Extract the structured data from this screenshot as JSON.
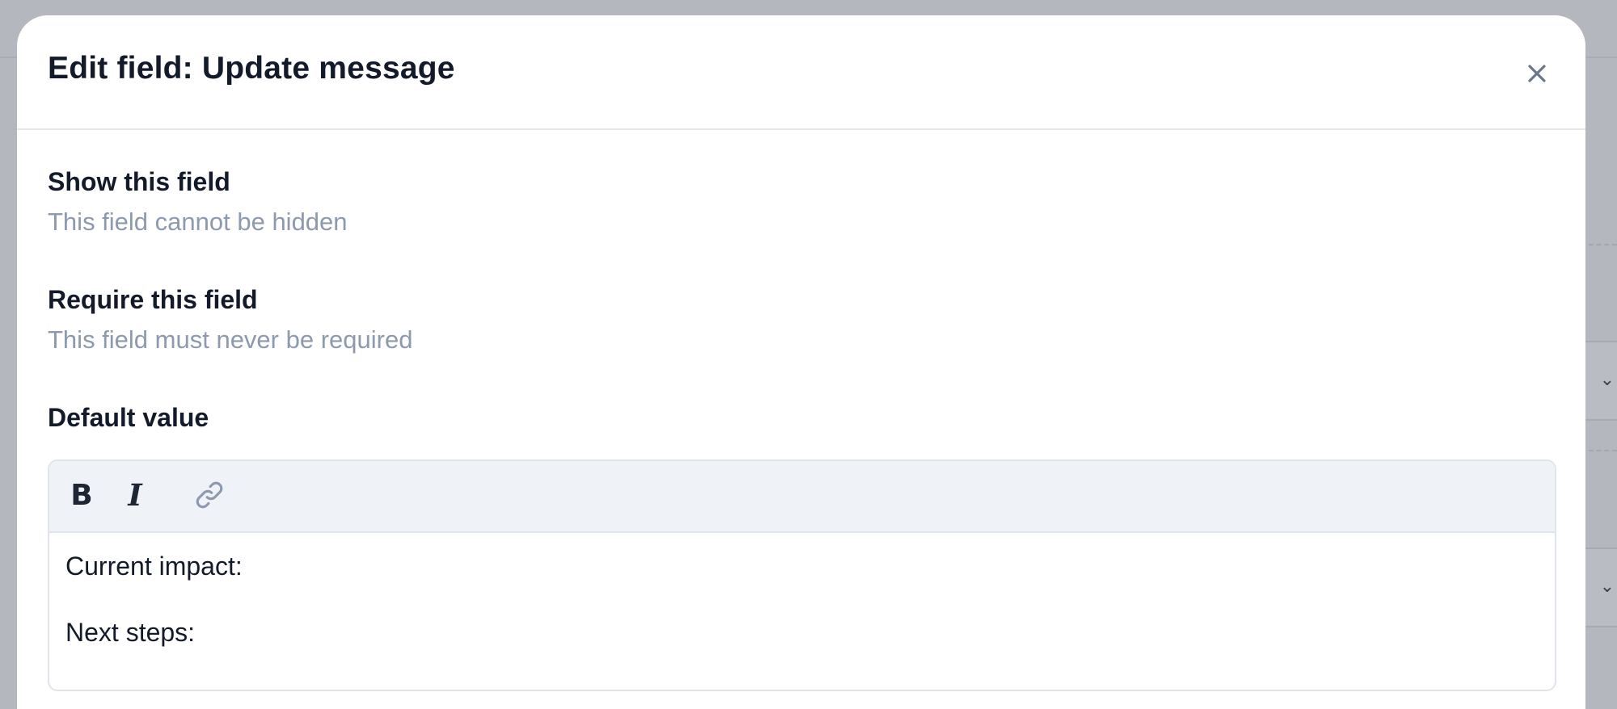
{
  "modal": {
    "title": "Edit field: Update message",
    "close_label": "Close"
  },
  "show_field": {
    "label": "Show this field",
    "help": "This field cannot be hidden"
  },
  "require_field": {
    "label": "Require this field",
    "help": "This field must never be required"
  },
  "default_value": {
    "label": "Default value",
    "toolbar": {
      "bold_glyph": "B",
      "italic_glyph": "I",
      "link_icon": "link-icon"
    },
    "content_lines": [
      "Current impact:",
      "Next steps:"
    ]
  },
  "colors": {
    "title_text": "#131a2a",
    "help_text": "#8c99ae",
    "toolbar_bg": "#eff2f7",
    "backdrop": "#b4b7bd"
  }
}
